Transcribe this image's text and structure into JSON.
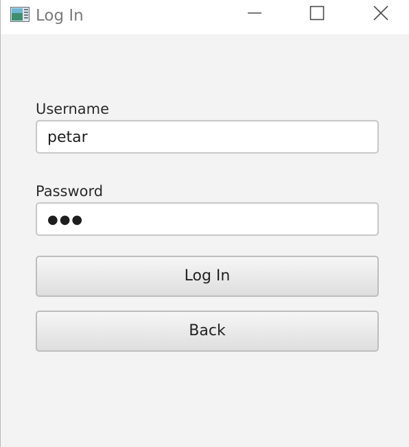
{
  "window": {
    "title": "Log In",
    "icon": "app-window-icon",
    "controls": {
      "minimize_icon": "minimize-icon",
      "maximize_icon": "maximize-icon",
      "close_icon": "close-icon"
    }
  },
  "form": {
    "username": {
      "label": "Username",
      "value": "petar"
    },
    "password": {
      "label": "Password",
      "masked_value": "●●●"
    },
    "login_button": "Log In",
    "back_button": "Back"
  },
  "colors": {
    "background": "#f3f3f3",
    "titlebar": "#ffffff",
    "field_border": "#c8c8c8",
    "button_border": "#bdbdbd",
    "text": "#222222",
    "title_text": "#7a7a7a"
  }
}
